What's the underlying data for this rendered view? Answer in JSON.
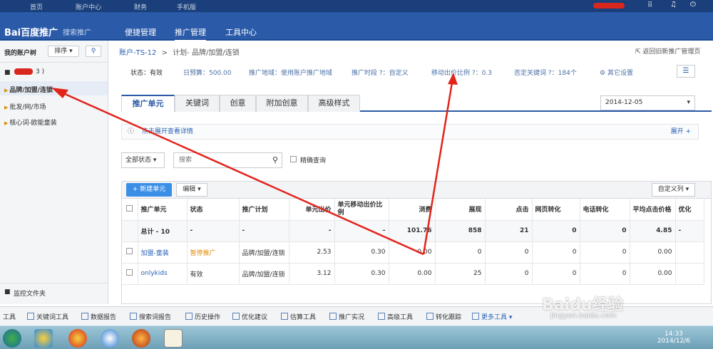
{
  "topbar": {
    "items": [
      "首页",
      "账户中心",
      "财务",
      "手机版"
    ]
  },
  "header": {
    "logo": "Bai百度推广",
    "subtitle": "搜索推广",
    "nav": [
      "便捷管理",
      "推广管理",
      "工具中心"
    ]
  },
  "sidebar": {
    "title": "我的账户树",
    "sort_label": "排序",
    "account_count": "3 )",
    "items": [
      "品牌/加盟/连锁",
      "批发/网/市场",
      "核心词-欧能童装"
    ],
    "monitor_label": "监控文件夹"
  },
  "breadcrumb": {
    "account": "账户-TS-12",
    "sep": ">",
    "plan": "计划- 品牌/加盟/连锁",
    "back": "返回旧新推广管理页"
  },
  "info": {
    "status": "状态：有效",
    "budget": "日预算：500.00",
    "region": "推广地域：使用账户推广地域",
    "period": "推广时段",
    "period_val": "：自定义",
    "mobile": "移动出价比例",
    "mobile_val": "：0.3",
    "neg": "否定关键词",
    "neg_val": "：184个",
    "settings": "其它设置"
  },
  "tabs": [
    "推广单元",
    "关键词",
    "创意",
    "附加创意",
    "高级样式"
  ],
  "date": "2014-12-05",
  "notice": {
    "text": "点击展开查看详情",
    "expand": "展开 +"
  },
  "filter": {
    "status": "全部状态",
    "search_placeholder": "搜索",
    "exact": "精确查询"
  },
  "toolbar": {
    "new_unit": "+ 新建单元",
    "edit": "编辑",
    "custom_cols": "自定义列"
  },
  "table": {
    "headers": [
      "推广单元",
      "状态",
      "推广计划",
      "单元出价",
      "单元移动出价比例",
      "消费",
      "展现",
      "点击",
      "网页转化",
      "电话转化",
      "平均点击价格",
      "优化"
    ],
    "total": [
      "总计 - 10",
      "-",
      "-",
      "-",
      "-",
      "101.76",
      "858",
      "21",
      "0",
      "0",
      "4.85",
      "-"
    ],
    "rows": [
      [
        "加盟-童装",
        "暂停推广",
        "品牌/加盟/连锁",
        "2.53",
        "0.30",
        "0.00",
        "0",
        "0",
        "0",
        "0",
        "0.00",
        ""
      ],
      [
        "onlykids",
        "有效",
        "品牌/加盟/连锁",
        "3.12",
        "0.30",
        "0.00",
        "25",
        "0",
        "0",
        "0",
        "0.00",
        ""
      ]
    ]
  },
  "bottom_tools": [
    "工具",
    "关键词工具",
    "数据报告",
    "搜索词报告",
    "历史操作",
    "优化建议",
    "估算工具",
    "推广实况",
    "高级工具",
    "转化跟踪",
    "更多工具"
  ],
  "clock": {
    "time": "14:33",
    "date": "2014/12/6"
  },
  "watermark": {
    "text": "Baidu经验",
    "url": "jingyan.baidu.com"
  }
}
